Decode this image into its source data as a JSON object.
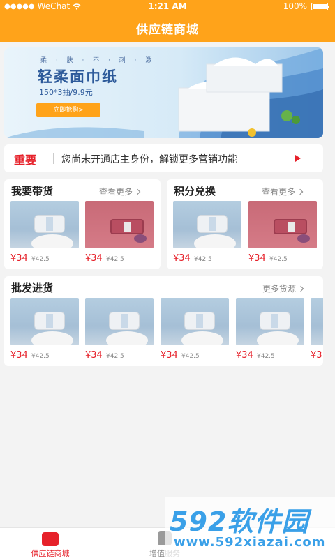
{
  "status_bar": {
    "carrier": "WeChat",
    "time": "1:21 AM",
    "battery": "100%"
  },
  "header": {
    "title": "供应链商城"
  },
  "banner": {
    "tag": "柔 · 肤 · 不 · 刺 · 激",
    "title": "轻柔面巾纸",
    "subtitle": "150*3抽/9.9元",
    "button": "立即抢购>"
  },
  "notice": {
    "tag": "重要",
    "text": "您尚未开通店主身份，解锁更多营销功能"
  },
  "sections": {
    "daihuo": {
      "title": "我要带货",
      "more": "查看更多",
      "items": [
        {
          "price": "¥34",
          "orig": "¥42.5"
        },
        {
          "price": "¥34",
          "orig": "¥42.5"
        }
      ]
    },
    "jifen": {
      "title": "积分兑换",
      "more": "查看更多",
      "items": [
        {
          "price": "¥34",
          "orig": "¥42.5"
        },
        {
          "price": "¥34",
          "orig": "¥42.5"
        }
      ]
    },
    "pifa": {
      "title": "批发进货",
      "more": "更多货源",
      "items": [
        {
          "price": "¥34",
          "orig": "¥42.5"
        },
        {
          "price": "¥34",
          "orig": "¥42.5"
        },
        {
          "price": "¥34",
          "orig": "¥42.5"
        },
        {
          "price": "¥34",
          "orig": "¥42.5"
        },
        {
          "price": "¥3",
          "orig": ""
        }
      ]
    }
  },
  "tabbar": {
    "items": [
      {
        "label": "供应链商城",
        "icon": "shop-bag-icon",
        "active": true
      },
      {
        "label": "增值服务",
        "icon": "service-icon",
        "active": false
      }
    ]
  },
  "watermark": {
    "big": "592软件园",
    "small": "www.592xiazai.com"
  },
  "colors": {
    "brand": "#ffa31a",
    "price": "#e6212a",
    "accent_blue": "#3aa0e8"
  }
}
